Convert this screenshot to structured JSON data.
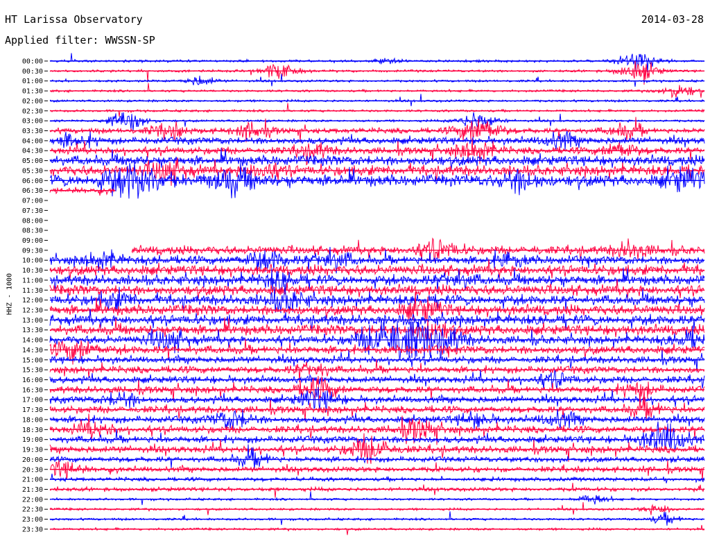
{
  "header": {
    "station": "HT Larissa Observatory",
    "date": "2014-03-28",
    "filter_label": "Applied filter: WWSSN-SP"
  },
  "chart_data": {
    "type": "line",
    "title": "HT Larissa Observatory",
    "subtitle": "Applied filter: WWSSN-SP",
    "date": "2014-03-28",
    "ylabel": "HHZ - 1000",
    "xlabel": "",
    "grid": false,
    "legend": "none",
    "trace_colors": {
      "even_row": "#0000ff",
      "odd_row": "#ff0040"
    },
    "row_labels": [
      "00:00",
      "00:30",
      "01:00",
      "01:30",
      "02:00",
      "02:30",
      "03:00",
      "03:30",
      "04:00",
      "04:30",
      "05:00",
      "05:30",
      "06:00",
      "06:30",
      "07:00",
      "07:30",
      "08:00",
      "08:30",
      "09:00",
      "09:30",
      "10:00",
      "10:30",
      "11:00",
      "11:30",
      "12:00",
      "12:30",
      "13:00",
      "13:30",
      "14:00",
      "14:30",
      "15:00",
      "15:30",
      "16:00",
      "16:30",
      "17:00",
      "17:30",
      "18:00",
      "18:30",
      "19:00",
      "19:30",
      "20:00",
      "20:30",
      "21:00",
      "21:30",
      "22:00",
      "22:30",
      "23:00",
      "23:30"
    ],
    "row_noise_level": [
      1,
      1,
      1,
      1,
      1,
      1,
      1,
      3,
      4,
      4,
      6,
      6,
      7,
      3,
      0,
      0,
      0,
      0,
      0,
      5,
      5,
      6,
      6,
      6,
      6,
      6,
      6,
      6,
      5,
      5,
      4,
      4,
      4,
      4,
      4,
      4,
      4,
      4,
      4,
      4,
      3,
      3,
      2,
      2,
      1,
      1,
      1,
      1
    ],
    "data_gap_rows": [
      "07:00",
      "07:30",
      "08:00",
      "08:30",
      "09:00"
    ],
    "partial_rows": {
      "06:30": [
        0.0,
        0.1
      ],
      "09:30": [
        0.125,
        1.0
      ]
    },
    "events": [
      {
        "row": "00:00",
        "pos": 0.515,
        "amp": 1
      },
      {
        "row": "00:00",
        "pos": 0.9,
        "amp": 4
      },
      {
        "row": "00:30",
        "pos": 0.35,
        "amp": 3
      },
      {
        "row": "00:30",
        "pos": 0.9,
        "amp": 4
      },
      {
        "row": "01:00",
        "pos": 0.23,
        "amp": 2
      },
      {
        "row": "01:30",
        "pos": 0.96,
        "amp": 3
      },
      {
        "row": "03:00",
        "pos": 0.12,
        "amp": 4
      },
      {
        "row": "03:00",
        "pos": 0.655,
        "amp": 4
      },
      {
        "row": "03:30",
        "pos": 0.18,
        "amp": 3
      },
      {
        "row": "03:30",
        "pos": 0.31,
        "amp": 3
      },
      {
        "row": "03:30",
        "pos": 0.655,
        "amp": 5
      },
      {
        "row": "03:30",
        "pos": 0.88,
        "amp": 3
      },
      {
        "row": "04:00",
        "pos": 0.04,
        "amp": 3
      },
      {
        "row": "04:00",
        "pos": 0.78,
        "amp": 3
      },
      {
        "row": "04:30",
        "pos": 0.4,
        "amp": 3
      },
      {
        "row": "04:30",
        "pos": 0.65,
        "amp": 4
      },
      {
        "row": "04:30",
        "pos": 0.87,
        "amp": 3
      },
      {
        "row": "05:30",
        "pos": 0.18,
        "amp": 4
      },
      {
        "row": "05:30",
        "pos": 0.33,
        "amp": 3
      },
      {
        "row": "06:00",
        "pos": 0.12,
        "amp": 7
      },
      {
        "row": "06:00",
        "pos": 0.28,
        "amp": 5
      },
      {
        "row": "06:00",
        "pos": 0.72,
        "amp": 4
      },
      {
        "row": "06:00",
        "pos": 0.97,
        "amp": 4
      },
      {
        "row": "09:30",
        "pos": 0.59,
        "amp": 4
      },
      {
        "row": "09:30",
        "pos": 0.89,
        "amp": 3
      },
      {
        "row": "10:00",
        "pos": 0.08,
        "amp": 3
      },
      {
        "row": "10:00",
        "pos": 0.33,
        "amp": 4
      },
      {
        "row": "10:00",
        "pos": 0.43,
        "amp": 4
      },
      {
        "row": "10:00",
        "pos": 0.7,
        "amp": 3
      },
      {
        "row": "11:00",
        "pos": 0.35,
        "amp": 3
      },
      {
        "row": "11:00",
        "pos": 0.62,
        "amp": 3
      },
      {
        "row": "12:00",
        "pos": 0.1,
        "amp": 3
      },
      {
        "row": "12:00",
        "pos": 0.36,
        "amp": 4
      },
      {
        "row": "12:30",
        "pos": 0.57,
        "amp": 4
      },
      {
        "row": "13:30",
        "pos": 0.58,
        "amp": 4
      },
      {
        "row": "14:00",
        "pos": 0.18,
        "amp": 4
      },
      {
        "row": "14:00",
        "pos": 0.5,
        "amp": 5
      },
      {
        "row": "14:00",
        "pos": 0.53,
        "amp": 5
      },
      {
        "row": "14:00",
        "pos": 0.56,
        "amp": 6
      },
      {
        "row": "14:00",
        "pos": 0.6,
        "amp": 5
      },
      {
        "row": "14:00",
        "pos": 0.98,
        "amp": 3
      },
      {
        "row": "14:30",
        "pos": 0.04,
        "amp": 4
      },
      {
        "row": "15:30",
        "pos": 0.4,
        "amp": 3
      },
      {
        "row": "16:00",
        "pos": 0.77,
        "amp": 3
      },
      {
        "row": "16:30",
        "pos": 0.41,
        "amp": 4
      },
      {
        "row": "16:30",
        "pos": 0.9,
        "amp": 3
      },
      {
        "row": "17:00",
        "pos": 0.11,
        "amp": 3
      },
      {
        "row": "17:00",
        "pos": 0.41,
        "amp": 4
      },
      {
        "row": "17:30",
        "pos": 0.91,
        "amp": 3
      },
      {
        "row": "18:00",
        "pos": 0.28,
        "amp": 4
      },
      {
        "row": "18:00",
        "pos": 0.65,
        "amp": 3
      },
      {
        "row": "18:00",
        "pos": 0.78,
        "amp": 3
      },
      {
        "row": "18:30",
        "pos": 0.07,
        "amp": 3
      },
      {
        "row": "18:30",
        "pos": 0.56,
        "amp": 4
      },
      {
        "row": "19:00",
        "pos": 0.94,
        "amp": 6
      },
      {
        "row": "19:30",
        "pos": 0.49,
        "amp": 5
      },
      {
        "row": "20:00",
        "pos": 0.31,
        "amp": 3
      },
      {
        "row": "20:30",
        "pos": 0.02,
        "amp": 3
      },
      {
        "row": "22:00",
        "pos": 0.83,
        "amp": 2
      },
      {
        "row": "22:30",
        "pos": 0.93,
        "amp": 2
      },
      {
        "row": "23:00",
        "pos": 0.94,
        "amp": 2
      }
    ]
  }
}
